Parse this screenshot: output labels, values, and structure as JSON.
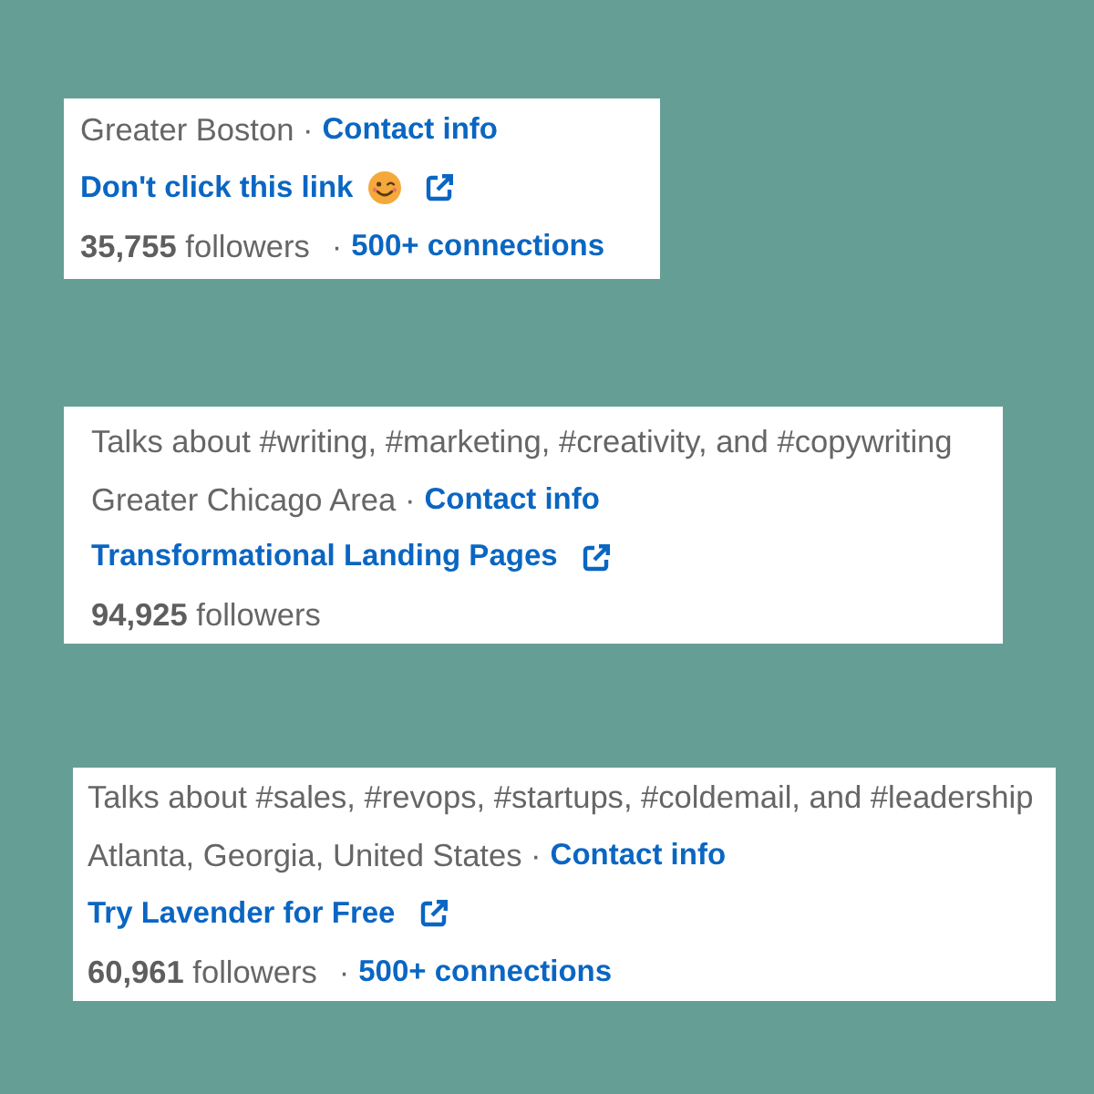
{
  "cards": [
    {
      "location": "Greater Boston ·",
      "contact_link": "Contact info",
      "website": {
        "label": "Don't click this link",
        "emoji": true
      },
      "followers": "**35,755** followers",
      "connections_separator": "·",
      "connections": "500+ connections"
    },
    {
      "topics": "Talks about #writing, #marketing, #creativity, and #copywriting",
      "location": "Greater Chicago Area ·",
      "contact_link": "Contact info",
      "website": {
        "label": "Transformational Landing Pages"
      },
      "followers": "**94,925** followers"
    },
    {
      "topics": "Talks about #sales, #revops, #startups, #coldemail, and #leadership",
      "location": "Atlanta, Georgia, United States ·",
      "contact_link": "Contact info",
      "website": {
        "label": "Try Lavender for Free"
      },
      "followers": "**60,961** followers",
      "connections_separator": "·",
      "connections": "500+ connections"
    }
  ]
}
